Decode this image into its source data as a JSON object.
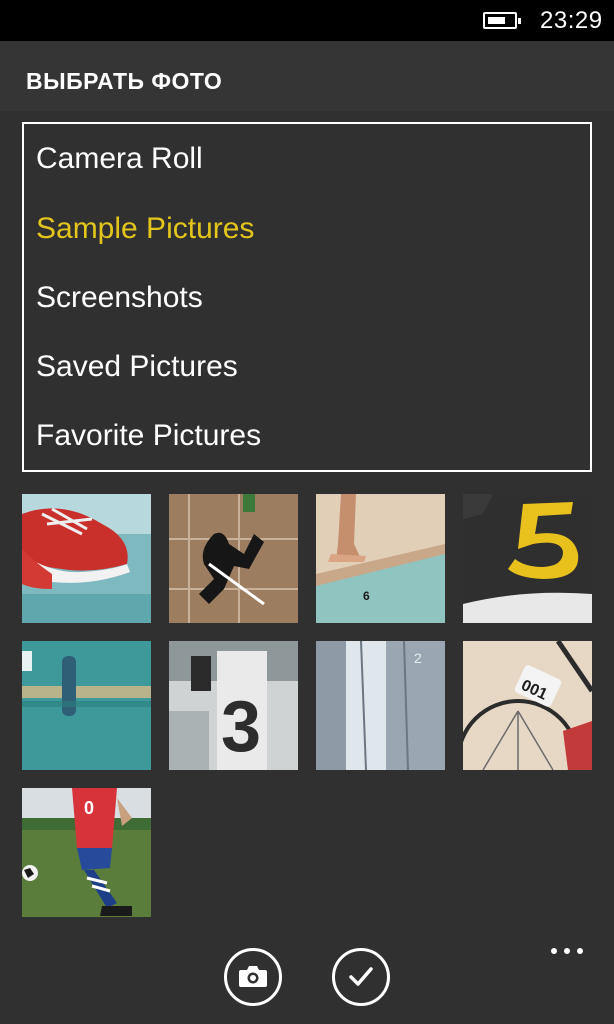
{
  "status_bar": {
    "time": "23:29",
    "battery_icon": "battery-icon"
  },
  "header": {
    "title": "ВЫБРАТЬ ФОТО"
  },
  "albums": [
    {
      "label": "Camera Roll",
      "selected": false
    },
    {
      "label": "Sample Pictures",
      "selected": true
    },
    {
      "label": "Screenshots",
      "selected": false
    },
    {
      "label": "Saved Pictures",
      "selected": false
    },
    {
      "label": "Favorite Pictures",
      "selected": false
    }
  ],
  "thumbnails": [
    {
      "subject": "red shoes"
    },
    {
      "subject": "hopscotch shadow"
    },
    {
      "subject": "poolside feet"
    },
    {
      "subject": "number 5 on asphalt"
    },
    {
      "subject": "teal door latch"
    },
    {
      "subject": "number 3 pillar"
    },
    {
      "subject": "glass building"
    },
    {
      "subject": "bicycle number 001"
    },
    {
      "subject": "soccer player"
    }
  ],
  "app_bar": {
    "buttons": [
      {
        "icon": "camera-icon"
      },
      {
        "icon": "checkmark-icon"
      }
    ],
    "more_icon": "more-dots-icon"
  },
  "colors": {
    "accent": "#e3c61c",
    "background": "#303030",
    "status_bar": "#000000"
  }
}
